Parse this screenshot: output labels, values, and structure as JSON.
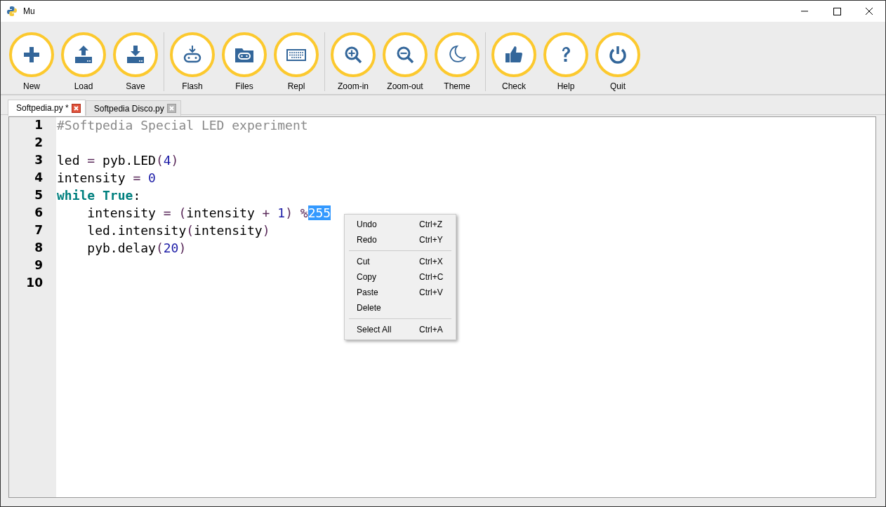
{
  "window": {
    "title": "Mu"
  },
  "toolbar": {
    "groups": [
      [
        {
          "label": "New"
        },
        {
          "label": "Load"
        },
        {
          "label": "Save"
        }
      ],
      [
        {
          "label": "Flash"
        },
        {
          "label": "Files"
        },
        {
          "label": "Repl"
        }
      ],
      [
        {
          "label": "Zoom-in"
        },
        {
          "label": "Zoom-out"
        },
        {
          "label": "Theme"
        }
      ],
      [
        {
          "label": "Check"
        },
        {
          "label": "Help"
        },
        {
          "label": "Quit"
        }
      ]
    ]
  },
  "tabs": [
    {
      "label": "Softpedia.py *",
      "selected": true
    },
    {
      "label": "Softpedia Disco.py",
      "selected": false
    }
  ],
  "editor": {
    "lines": [
      {
        "number": "1",
        "tokens": [
          {
            "kind": "comment",
            "text": "#Softpedia Special LED experiment",
            "selected": false
          }
        ]
      },
      {
        "number": "2"
      },
      {
        "number": "3",
        "tokens": [
          {
            "kind": "plain",
            "text": "led ",
            "selected": false
          },
          {
            "kind": "operator",
            "text": "=",
            "selected": false
          },
          {
            "kind": "plain",
            "text": " pyb.LED",
            "selected": false
          },
          {
            "kind": "operator",
            "text": "(",
            "selected": false
          },
          {
            "kind": "number",
            "text": "4",
            "selected": false
          },
          {
            "kind": "operator",
            "text": ")",
            "selected": false
          }
        ]
      },
      {
        "number": "4",
        "tokens": [
          {
            "kind": "plain",
            "text": "intensity ",
            "selected": false
          },
          {
            "kind": "operator",
            "text": "=",
            "selected": false
          },
          {
            "kind": "number",
            "text": " 0",
            "selected": false
          }
        ]
      },
      {
        "number": "5",
        "tokens": [
          {
            "kind": "keyword",
            "text": "while True",
            "selected": false
          },
          {
            "kind": "plain",
            "text": ":",
            "selected": false
          }
        ]
      },
      {
        "number": "6",
        "tokens": [
          {
            "kind": "plain",
            "text": "    intensity ",
            "selected": false
          },
          {
            "kind": "operator",
            "text": "= (",
            "selected": false
          },
          {
            "kind": "plain",
            "text": "intensity ",
            "selected": false
          },
          {
            "kind": "operator",
            "text": "+",
            "selected": false
          },
          {
            "kind": "number",
            "text": " 1",
            "selected": false
          },
          {
            "kind": "operator",
            "text": ") %",
            "selected": false
          },
          {
            "kind": "number",
            "text": "255",
            "selected": true
          }
        ]
      },
      {
        "number": "7",
        "tokens": [
          {
            "kind": "plain",
            "text": "    led.intensity",
            "selected": false
          },
          {
            "kind": "operator",
            "text": "(",
            "selected": false
          },
          {
            "kind": "plain",
            "text": "intensity",
            "selected": false
          },
          {
            "kind": "operator",
            "text": ")",
            "selected": false
          }
        ]
      },
      {
        "number": "8",
        "tokens": [
          {
            "kind": "plain",
            "text": "    pyb.delay",
            "selected": false
          },
          {
            "kind": "operator",
            "text": "(",
            "selected": false
          },
          {
            "kind": "number",
            "text": "20",
            "selected": false
          },
          {
            "kind": "operator",
            "text": ")",
            "selected": false
          }
        ]
      },
      {
        "number": "9"
      },
      {
        "number": "10"
      }
    ]
  },
  "context_menu": {
    "items": [
      {
        "kind": "item",
        "label": "Undo",
        "shortcut": "Ctrl+Z"
      },
      {
        "kind": "item",
        "label": "Redo",
        "shortcut": "Ctrl+Y"
      },
      {
        "kind": "separator"
      },
      {
        "kind": "item",
        "label": "Cut",
        "shortcut": "Ctrl+X"
      },
      {
        "kind": "item",
        "label": "Copy",
        "shortcut": "Ctrl+C"
      },
      {
        "kind": "item",
        "label": "Paste",
        "shortcut": "Ctrl+V"
      },
      {
        "kind": "item",
        "label": "Delete"
      },
      {
        "kind": "separator"
      },
      {
        "kind": "item",
        "label": "Select All",
        "shortcut": "Ctrl+A"
      }
    ]
  }
}
